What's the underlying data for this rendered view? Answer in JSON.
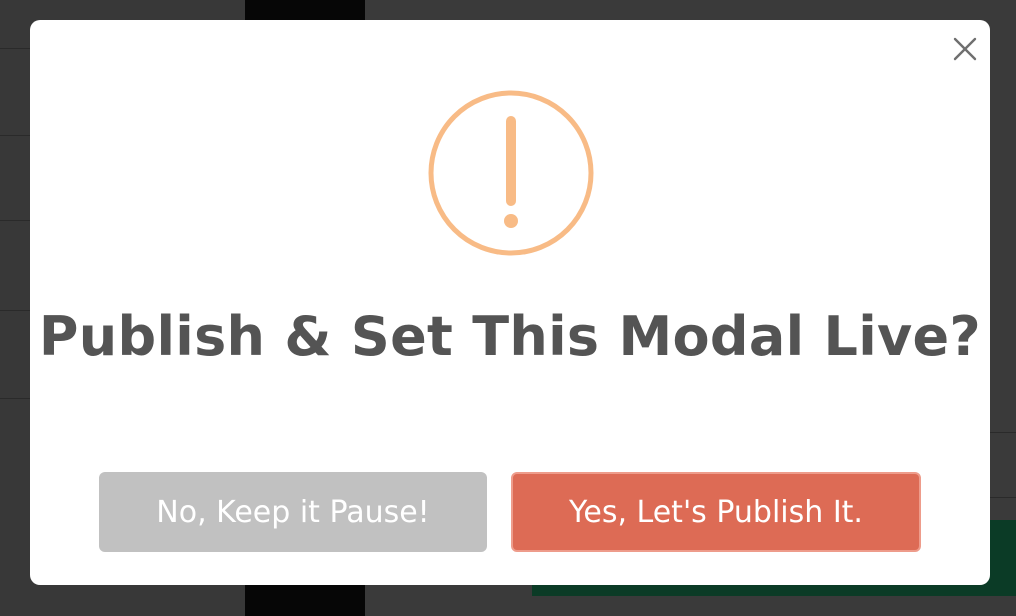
{
  "modal": {
    "title": "Publish & Set This Modal Live?",
    "icon": "warning-exclamation-icon",
    "icon_color": "#f8bb86",
    "close_icon": "close-icon",
    "buttons": {
      "cancel_label": "No, Keep it Pause!",
      "confirm_label": "Yes, Let's Publish It.",
      "cancel_color": "#c1c1c1",
      "confirm_color": "#dd6b55"
    }
  },
  "colors": {
    "overlay": "#2c2c2c",
    "title_text": "#545454"
  }
}
